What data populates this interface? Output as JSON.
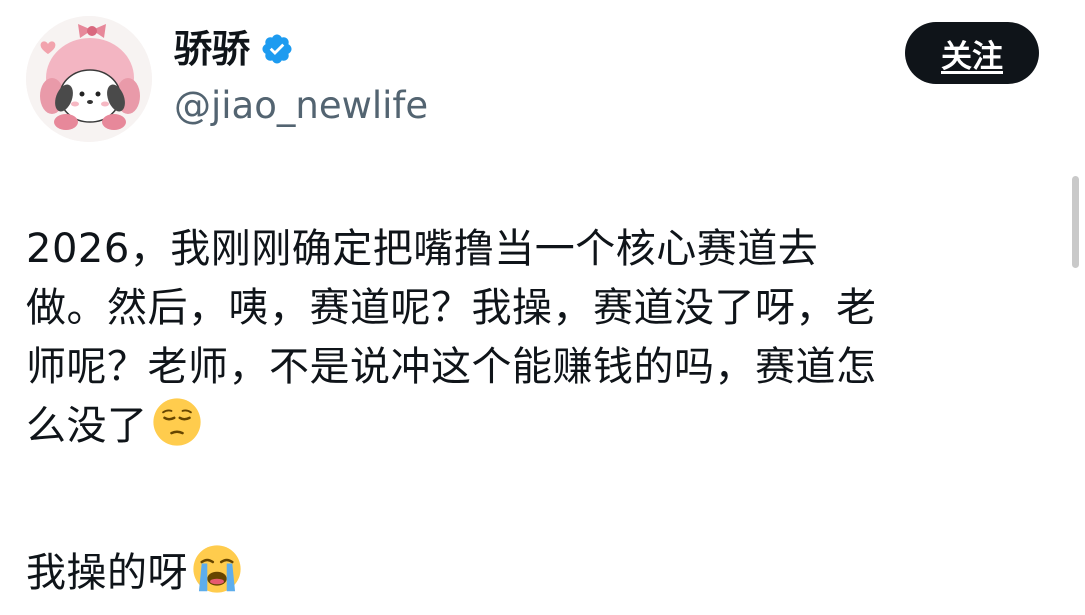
{
  "user": {
    "display_name": "骄骄",
    "handle": "@jiao_newlife",
    "verified": true,
    "avatar_icon": "avatar-illustration"
  },
  "follow_button": {
    "label": "关注"
  },
  "post": {
    "lines": [
      "2026，我刚刚确定把嘴撸当一个核心赛道去",
      "做。然后，咦，赛道呢？我操，赛道没了呀，老",
      "师呢？老师，不是说冲这个能赚钱的吗，赛道怎",
      "么没了"
    ],
    "last_line": "我操的呀",
    "emojis": {
      "first": "pensive-face-emoji",
      "second": "loudly-crying-face-emoji"
    }
  },
  "colors": {
    "text": "#0f1419",
    "secondary": "#536471",
    "verified_badge": "#1d9bf0",
    "button_bg": "#0f1419",
    "button_text": "#ffffff"
  }
}
